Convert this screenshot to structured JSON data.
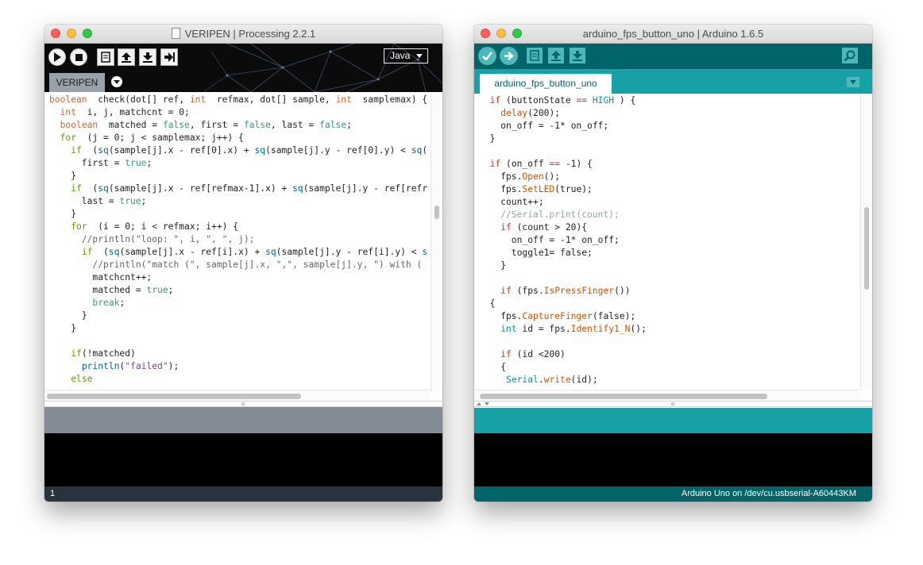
{
  "processing": {
    "title": "VERIPEN | Processing 2.2.1",
    "mode": "Java",
    "tab": "VERIPEN",
    "line_number": "1",
    "code": [
      [
        [
          "k",
          "boolean"
        ],
        [
          "",
          "  check(dot[] ref, "
        ],
        [
          "k",
          "int"
        ],
        [
          "",
          "  refmax, dot[] sample, "
        ],
        [
          "k",
          "int"
        ],
        [
          "",
          "  samplemax) {"
        ]
      ],
      [
        [
          "",
          "  "
        ],
        [
          "k",
          "int"
        ],
        [
          "",
          "  i, j, matchcnt = 0;"
        ]
      ],
      [
        [
          "",
          "  "
        ],
        [
          "k",
          "boolean"
        ],
        [
          "",
          "  matched = "
        ],
        [
          "kb",
          "false"
        ],
        [
          "",
          ", first = "
        ],
        [
          "kb",
          "false"
        ],
        [
          "",
          ", last = "
        ],
        [
          "kb",
          "false"
        ],
        [
          "",
          ";"
        ]
      ],
      [
        [
          "",
          "  "
        ],
        [
          "kp",
          "for"
        ],
        [
          "",
          "  (j = 0; j < samplemax; j++) {"
        ]
      ],
      [
        [
          "",
          "    "
        ],
        [
          "kp",
          "if"
        ],
        [
          "",
          "  ("
        ],
        [
          "kf",
          "sq"
        ],
        [
          "",
          "(sample[j].x - ref[0].x) + "
        ],
        [
          "kf",
          "sq"
        ],
        [
          "",
          "(sample[j].y - ref[0].y) < "
        ],
        [
          "kf",
          "sq"
        ],
        [
          "",
          "("
        ]
      ],
      [
        [
          "",
          "      first = "
        ],
        [
          "kb",
          "true"
        ],
        [
          "",
          ";"
        ]
      ],
      [
        [
          "",
          "    }"
        ]
      ],
      [
        [
          "",
          "    "
        ],
        [
          "kp",
          "if"
        ],
        [
          "",
          "  ("
        ],
        [
          "kf",
          "sq"
        ],
        [
          "",
          "(sample[j].x - ref[refmax-1].x) + "
        ],
        [
          "kf",
          "sq"
        ],
        [
          "",
          "(sample[j].y - ref[refr"
        ]
      ],
      [
        [
          "",
          "      last = "
        ],
        [
          "kb",
          "true"
        ],
        [
          "",
          ";"
        ]
      ],
      [
        [
          "",
          "    }"
        ]
      ],
      [
        [
          "",
          "    "
        ],
        [
          "kp",
          "for"
        ],
        [
          "",
          "  (i = 0; i < refmax; i++) {"
        ]
      ],
      [
        [
          "",
          "      "
        ],
        [
          "kc",
          "//println(\"loop: \", i, \", \", j);"
        ]
      ],
      [
        [
          "",
          "      "
        ],
        [
          "kp",
          "if"
        ],
        [
          "",
          "  ("
        ],
        [
          "kf",
          "sq"
        ],
        [
          "",
          "(sample[j].x - ref[i].x) + "
        ],
        [
          "kf",
          "sq"
        ],
        [
          "",
          "(sample[j].y - ref[i].y) < "
        ],
        [
          "kf",
          "s"
        ]
      ],
      [
        [
          "",
          "        "
        ],
        [
          "kc",
          "//println(\"match (\", sample[j].x, \",\", sample[j].y, \") with ("
        ]
      ],
      [
        [
          "",
          "        matchcnt++;"
        ]
      ],
      [
        [
          "",
          "        matched = "
        ],
        [
          "kb",
          "true"
        ],
        [
          "",
          ";"
        ]
      ],
      [
        [
          "",
          "        "
        ],
        [
          "kb",
          "break"
        ],
        [
          "",
          ";"
        ]
      ],
      [
        [
          "",
          "      }"
        ]
      ],
      [
        [
          "",
          "    }"
        ]
      ],
      [
        [
          "",
          ""
        ]
      ],
      [
        [
          "",
          "    "
        ],
        [
          "kp",
          "if"
        ],
        [
          "",
          "(!matched)"
        ]
      ],
      [
        [
          "",
          "      "
        ],
        [
          "kf",
          "println"
        ],
        [
          "",
          "("
        ],
        [
          "ks",
          "\"failed\""
        ],
        [
          "",
          ");"
        ]
      ],
      [
        [
          "",
          "    "
        ],
        [
          "kp",
          "else"
        ]
      ]
    ]
  },
  "arduino": {
    "title": "arduino_fps_button_uno | Arduino 1.6.5",
    "tab": "arduino_fps_button_uno",
    "status": "Arduino Uno on /dev/cu.usbserial-A60443KM",
    "code": [
      [
        [
          "",
          "  "
        ],
        [
          "ak",
          "if"
        ],
        [
          "",
          " (buttonState "
        ],
        [
          "ak",
          "=="
        ],
        [
          "",
          " "
        ],
        [
          "at",
          "HIGH"
        ],
        [
          "",
          " ) {"
        ]
      ],
      [
        [
          "",
          "    "
        ],
        [
          "af",
          "delay"
        ],
        [
          "",
          "(200);"
        ]
      ],
      [
        [
          "",
          "    on_off = -1* on_off;"
        ]
      ],
      [
        [
          "",
          "  }"
        ]
      ],
      [
        [
          "",
          ""
        ]
      ],
      [
        [
          "",
          "  "
        ],
        [
          "ak",
          "if"
        ],
        [
          "",
          " (on_off "
        ],
        [
          "ak",
          "=="
        ],
        [
          "",
          " -1) {"
        ]
      ],
      [
        [
          "",
          "    fps."
        ],
        [
          "af",
          "Open"
        ],
        [
          "",
          "();"
        ]
      ],
      [
        [
          "",
          "    fps."
        ],
        [
          "af",
          "SetLED"
        ],
        [
          "",
          "(true);"
        ]
      ],
      [
        [
          "",
          "    count++;"
        ]
      ],
      [
        [
          "",
          "    "
        ],
        [
          "ac",
          "//Serial.print(count);"
        ]
      ],
      [
        [
          "",
          "    "
        ],
        [
          "ak",
          "if"
        ],
        [
          "",
          " (count > 20){"
        ]
      ],
      [
        [
          "",
          "      on_off = -1* on_off;"
        ]
      ],
      [
        [
          "",
          "      toggle1= false;"
        ]
      ],
      [
        [
          "",
          "    }"
        ]
      ],
      [
        [
          "",
          ""
        ]
      ],
      [
        [
          "",
          "    "
        ],
        [
          "ak",
          "if"
        ],
        [
          "",
          " (fps."
        ],
        [
          "af",
          "IsPressFinger"
        ],
        [
          "",
          "())"
        ]
      ],
      [
        [
          "",
          "  {"
        ]
      ],
      [
        [
          "",
          "    fps."
        ],
        [
          "af",
          "CaptureFinger"
        ],
        [
          "",
          "(false);"
        ]
      ],
      [
        [
          "",
          "    "
        ],
        [
          "at",
          "int"
        ],
        [
          "",
          " id = fps."
        ],
        [
          "af",
          "Identify1_N"
        ],
        [
          "",
          "();"
        ]
      ],
      [
        [
          "",
          ""
        ]
      ],
      [
        [
          "",
          "    "
        ],
        [
          "ak",
          "if"
        ],
        [
          "",
          " (id <200)"
        ]
      ],
      [
        [
          "",
          "    {"
        ]
      ],
      [
        [
          "",
          "     "
        ],
        [
          "at",
          "Serial"
        ],
        [
          "",
          "."
        ],
        [
          "af",
          "write"
        ],
        [
          "",
          "(id);"
        ]
      ]
    ]
  }
}
